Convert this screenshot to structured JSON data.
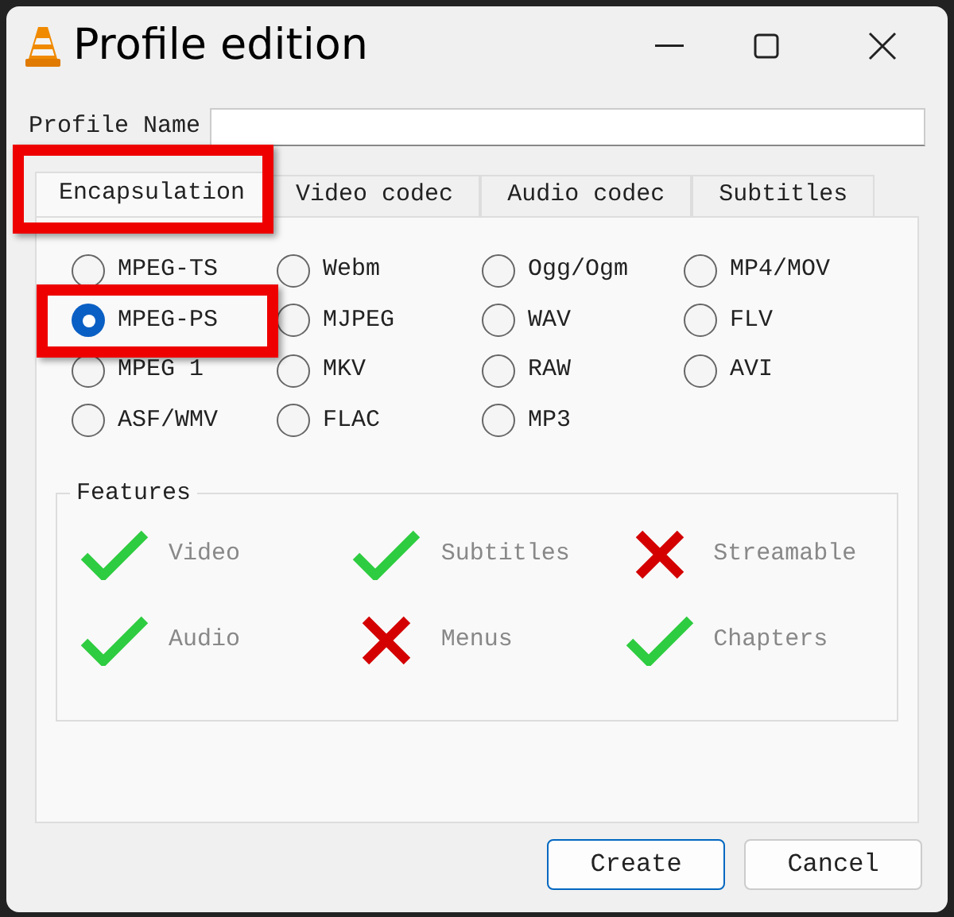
{
  "window": {
    "title": "Profile edition"
  },
  "profile_name": {
    "label": "Profile Name"
  },
  "tabs": [
    {
      "label": "Encapsulation",
      "selected": true,
      "highlighted": true
    },
    {
      "label": "Video codec",
      "selected": false,
      "highlighted": false
    },
    {
      "label": "Audio codec",
      "selected": false,
      "highlighted": false
    },
    {
      "label": "Subtitles",
      "selected": false,
      "highlighted": false
    }
  ],
  "formats": [
    [
      {
        "label": "MPEG-TS",
        "selected": false,
        "highlighted": false
      },
      {
        "label": "Webm",
        "selected": false,
        "highlighted": false
      },
      {
        "label": "Ogg/Ogm",
        "selected": false,
        "highlighted": false
      },
      {
        "label": "MP4/MOV",
        "selected": false,
        "highlighted": false
      }
    ],
    [
      {
        "label": "MPEG-PS",
        "selected": true,
        "highlighted": true
      },
      {
        "label": "MJPEG",
        "selected": false,
        "highlighted": false
      },
      {
        "label": "WAV",
        "selected": false,
        "highlighted": false
      },
      {
        "label": "FLV",
        "selected": false,
        "highlighted": false
      }
    ],
    [
      {
        "label": "MPEG 1",
        "selected": false,
        "highlighted": false
      },
      {
        "label": "MKV",
        "selected": false,
        "highlighted": false
      },
      {
        "label": "RAW",
        "selected": false,
        "highlighted": false
      },
      {
        "label": "AVI",
        "selected": false,
        "highlighted": false
      }
    ],
    [
      {
        "label": "ASF/WMV",
        "selected": false,
        "highlighted": false
      },
      {
        "label": "FLAC",
        "selected": false,
        "highlighted": false
      },
      {
        "label": "MP3",
        "selected": false,
        "highlighted": false
      }
    ]
  ],
  "features": {
    "title": "Features",
    "items": [
      {
        "label": "Video",
        "supported": true
      },
      {
        "label": "Subtitles",
        "supported": true
      },
      {
        "label": "Streamable",
        "supported": false
      },
      {
        "label": "Audio",
        "supported": true
      },
      {
        "label": "Menus",
        "supported": false
      },
      {
        "label": "Chapters",
        "supported": true
      }
    ]
  },
  "buttons": [
    {
      "label": "Create",
      "default": true
    },
    {
      "label": "Cancel",
      "default": false
    }
  ]
}
